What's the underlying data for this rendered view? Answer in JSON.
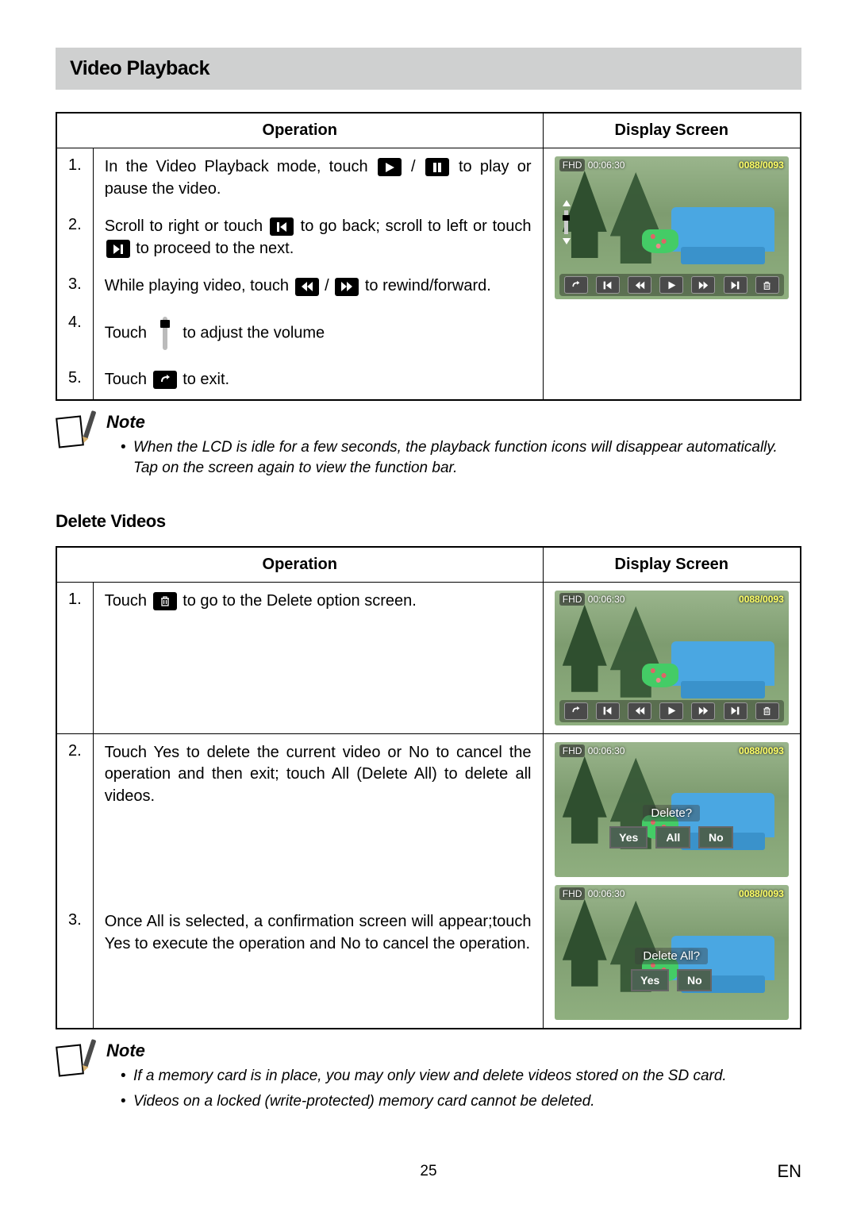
{
  "section": {
    "title": "Video Playback",
    "table1": {
      "operation_header": "Operation",
      "display_header": "Display Screen",
      "steps": [
        {
          "num": "1.",
          "pre": "In the Video Playback mode, touch ",
          "post": " to play or pause the video."
        },
        {
          "num": "2.",
          "pre": "Scroll to right or touch ",
          "mid": " to go back; scroll to left or touch ",
          "post": " to proceed to the next."
        },
        {
          "num": "3.",
          "pre": "While playing video, touch ",
          "post": " to rewind/forward."
        },
        {
          "num": "4.",
          "pre": "Touch ",
          "post": " to adjust the volume"
        },
        {
          "num": "5.",
          "pre": "Touch ",
          "post": " to exit."
        }
      ],
      "screen": {
        "resolution": "FHD",
        "timecode": "00:06:30",
        "counter": "0088/0093"
      }
    },
    "note1": {
      "title": "Note",
      "items": [
        "When the LCD is idle for a few seconds, the playback function icons will disappear automatically. Tap on the screen again to view the function bar."
      ]
    }
  },
  "subsection": {
    "title": "Delete Videos",
    "table2": {
      "operation_header": "Operation",
      "display_header": "Display Screen",
      "step1": {
        "num": "1.",
        "pre": "Touch ",
        "post": " to go to the Delete option screen."
      },
      "step2": {
        "num": "2.",
        "text": "Touch Yes to delete the current video or No  to cancel the operation and then exit; touch All (Delete All)  to delete all videos."
      },
      "step3": {
        "num": "3.",
        "text_pre": "Once All  is selected, a confirmation screen will appear;",
        "text_post": "touch Yes  to execute the operation and No  to cancel the operation."
      },
      "screens": {
        "s1": {
          "resolution": "FHD",
          "timecode": "00:06:30",
          "counter": "0088/0093"
        },
        "s2": {
          "resolution": "FHD",
          "timecode": "00:06:30",
          "counter": "0088/0093",
          "prompt": "Delete?",
          "yes": "Yes",
          "all": "All",
          "no": "No"
        },
        "s3": {
          "resolution": "FHD",
          "timecode": "00:06:30",
          "counter": "0088/0093",
          "prompt": "Delete All?",
          "yes": "Yes",
          "no": "No"
        }
      }
    },
    "note2": {
      "title": "Note",
      "items": [
        "If a memory card is in place, you may  only view and delete videos stored on the SD card.",
        "Videos on a locked (write-protected) memory card cannot be deleted."
      ]
    }
  },
  "footer": {
    "page": "25",
    "lang": "EN"
  }
}
